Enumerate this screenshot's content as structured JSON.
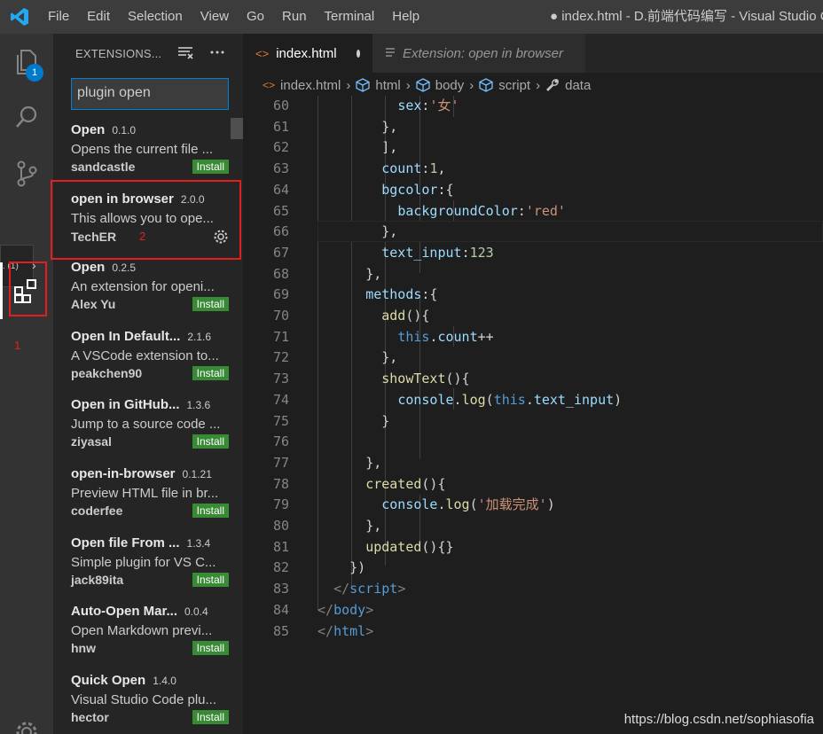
{
  "menu": {
    "items": [
      "File",
      "Edit",
      "Selection",
      "View",
      "Go",
      "Run",
      "Terminal",
      "Help"
    ],
    "window_title": "● index.html - D.前端代码编写 - Visual Studio C"
  },
  "activity": {
    "explorer_badge": "1",
    "annotation_1": "1",
    "hover_tip": ". (1)"
  },
  "sidebar": {
    "title": "EXTENSIONS...",
    "search_value": "plugin open",
    "annotation_2": "2",
    "items": [
      {
        "name": "Open",
        "version": "0.1.0",
        "desc": "Opens the current file ...",
        "publisher": "sandcastle",
        "action": "Install"
      },
      {
        "name": "open in browser",
        "version": "2.0.0",
        "desc": "This allows you to ope...",
        "publisher": "TechER",
        "action": ""
      },
      {
        "name": "Open",
        "version": "0.2.5",
        "desc": "An extension for openi...",
        "publisher": "Alex Yu",
        "action": "Install"
      },
      {
        "name": "Open In Default...",
        "version": "2.1.6",
        "desc": "A VSCode extension to...",
        "publisher": "peakchen90",
        "action": "Install"
      },
      {
        "name": "Open in GitHub...",
        "version": "1.3.6",
        "desc": "Jump to a source code ...",
        "publisher": "ziyasal",
        "action": "Install"
      },
      {
        "name": "open-in-browser",
        "version": "0.1.21",
        "desc": "Preview HTML file in br...",
        "publisher": "coderfee",
        "action": "Install"
      },
      {
        "name": "Open file From ...",
        "version": "1.3.4",
        "desc": "Simple plugin for VS C...",
        "publisher": "jack89ita",
        "action": "Install"
      },
      {
        "name": "Auto-Open Mar...",
        "version": "0.0.4",
        "desc": "Open Markdown previ...",
        "publisher": "hnw",
        "action": "Install"
      },
      {
        "name": "Quick Open",
        "version": "1.4.0",
        "desc": "Visual Studio Code plu...",
        "publisher": "hector",
        "action": "Install"
      }
    ]
  },
  "tabs": {
    "active": "index.html",
    "inactive": "Extension: open in browser"
  },
  "breadcrumb": [
    "index.html",
    "html",
    "body",
    "script",
    "data"
  ],
  "code": {
    "line_numbers": [
      "60",
      "61",
      "62",
      "63",
      "64",
      "65",
      "66",
      "67",
      "68",
      "69",
      "70",
      "71",
      "72",
      "73",
      "74",
      "75",
      "76",
      "77",
      "78",
      "79",
      "80",
      "81",
      "82",
      "83",
      "84",
      "85"
    ]
  },
  "watermark": "https://blog.csdn.net/sophiasofia",
  "colors": {
    "accent": "#007acc",
    "install": "#388a34",
    "annotation_red": "#e02020"
  }
}
